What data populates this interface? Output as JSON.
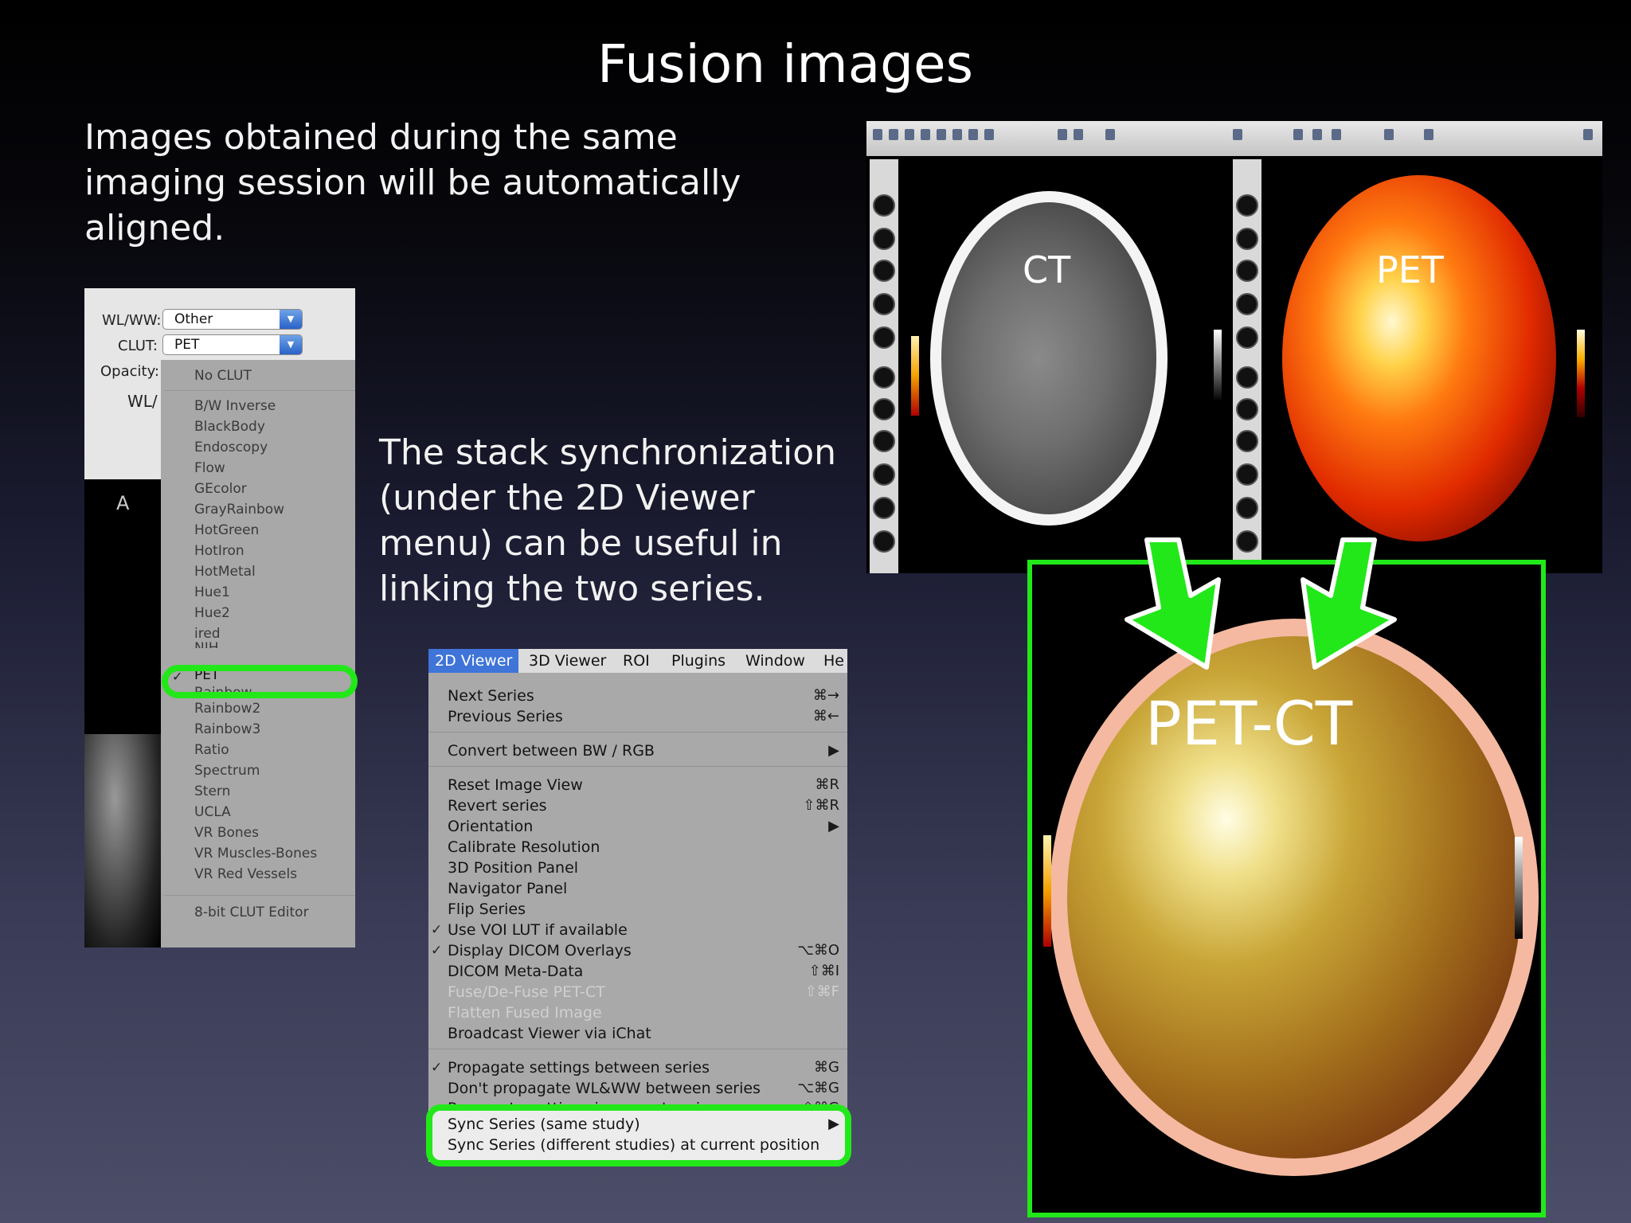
{
  "slide": {
    "title": "Fusion images",
    "intro": "Images obtained during the same imaging session will be automatically aligned.",
    "body": "The stack synchronization (under the 2D Viewer menu) can be useful in linking the two series."
  },
  "clut_panel": {
    "wlww_label": "WL/WW:",
    "wlww_value": "Other",
    "clut_label": "CLUT:",
    "clut_value": "PET",
    "opacity_label": "Opacity:",
    "wl_label": "WL/",
    "orientation_marker": "A",
    "items": [
      "No CLUT",
      "B/W Inverse",
      "BlackBody",
      "Endoscopy",
      "Flow",
      "GEcolor",
      "GrayRainbow",
      "HotGreen",
      "HotIron",
      "HotMetal",
      "Hue1",
      "Hue2",
      "ired",
      "NIH",
      "PET",
      "Rainbow",
      "Rainbow2",
      "Rainbow3",
      "Ratio",
      "Spectrum",
      "Stern",
      "UCLA",
      "VR Bones",
      "VR Muscles-Bones",
      "VR Red Vessels",
      "8-bit CLUT Editor"
    ],
    "selected": "PET"
  },
  "menu": {
    "bar": [
      "2D Viewer",
      "3D Viewer",
      "ROI",
      "Plugins",
      "Window",
      "He"
    ],
    "active": "2D Viewer",
    "items": {
      "next_series": {
        "label": "Next Series",
        "shortcut": "⌘→"
      },
      "previous_series": {
        "label": "Previous Series",
        "shortcut": "⌘←"
      },
      "convert": {
        "label": "Convert between BW / RGB",
        "shortcut": "▶"
      },
      "reset_view": {
        "label": "Reset Image View",
        "shortcut": "⌘R"
      },
      "revert_series": {
        "label": "Revert series",
        "shortcut": "⇧⌘R"
      },
      "orientation": {
        "label": "Orientation",
        "shortcut": "▶"
      },
      "calibrate": {
        "label": "Calibrate Resolution"
      },
      "position_panel": {
        "label": "3D Position Panel"
      },
      "navigator": {
        "label": "Navigator Panel"
      },
      "flip": {
        "label": "Flip Series"
      },
      "voi_lut": {
        "label": "Use VOI LUT if available",
        "checked": true
      },
      "dicom_overlays": {
        "label": "Display DICOM Overlays",
        "shortcut": "⌥⌘O",
        "checked": true
      },
      "meta_data": {
        "label": "DICOM Meta-Data",
        "shortcut": "⇧⌘I"
      },
      "fuse": {
        "label": "Fuse/De-Fuse PET-CT",
        "shortcut": "⇧⌘F",
        "disabled": true
      },
      "flatten": {
        "label": "Flatten Fused Image",
        "disabled": true
      },
      "broadcast": {
        "label": "Broadcast Viewer via iChat"
      },
      "propagate": {
        "label": "Propagate settings between series",
        "shortcut": "⌘G",
        "checked": true
      },
      "dont_propagate": {
        "label": "Don't propagate WL&WW between series",
        "shortcut": "⌥⌘G"
      },
      "propagate_current": {
        "label": "Propagate settings in current series",
        "shortcut": "⇧⌘G"
      },
      "sync_same": {
        "label": "Sync Series (same study)",
        "shortcut": "▶"
      },
      "sync_different": {
        "label": "Sync Series (different studies) at current position"
      }
    }
  },
  "viewer": {
    "ct_label": "CT",
    "pet_label": "PET",
    "fusion_label": "PET-CT"
  },
  "colors": {
    "highlight": "#22e81a",
    "menu_active": "#3f74d8"
  }
}
